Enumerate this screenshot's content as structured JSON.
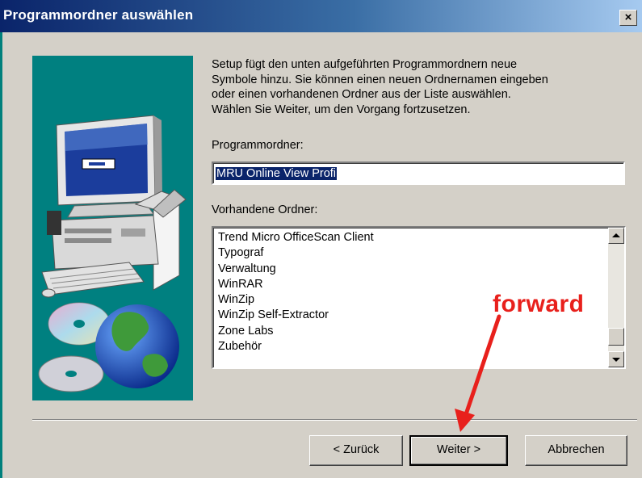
{
  "window": {
    "title": "Programmordner auswählen",
    "close_label": "×"
  },
  "description": "Setup fügt den unten aufgeführten Programmordnern neue\nSymbole hinzu. Sie können einen neuen Ordnernamen eingeben\noder einen vorhandenen Ordner aus der Liste auswählen.\nWählen Sie Weiter, um den Vorgang fortzusetzen.",
  "program_folder": {
    "label": "Programmordner:",
    "value": "MRU Online View Profi"
  },
  "existing_folders": {
    "label": "Vorhandene Ordner:",
    "items": [
      "Trend Micro OfficeScan Client",
      "Typograf",
      "Verwaltung",
      "WinRAR",
      "WinZip",
      "WinZip Self-Extractor",
      "Zone Labs",
      "Zubehör"
    ]
  },
  "buttons": {
    "back": "< Zurück",
    "next": "Weiter >",
    "cancel": "Abbrechen"
  },
  "annotation": {
    "text": "forward",
    "color": "#e8201c"
  },
  "icons": [
    "computer-setup-icon",
    "cd-discs-icon",
    "globe-icon"
  ]
}
